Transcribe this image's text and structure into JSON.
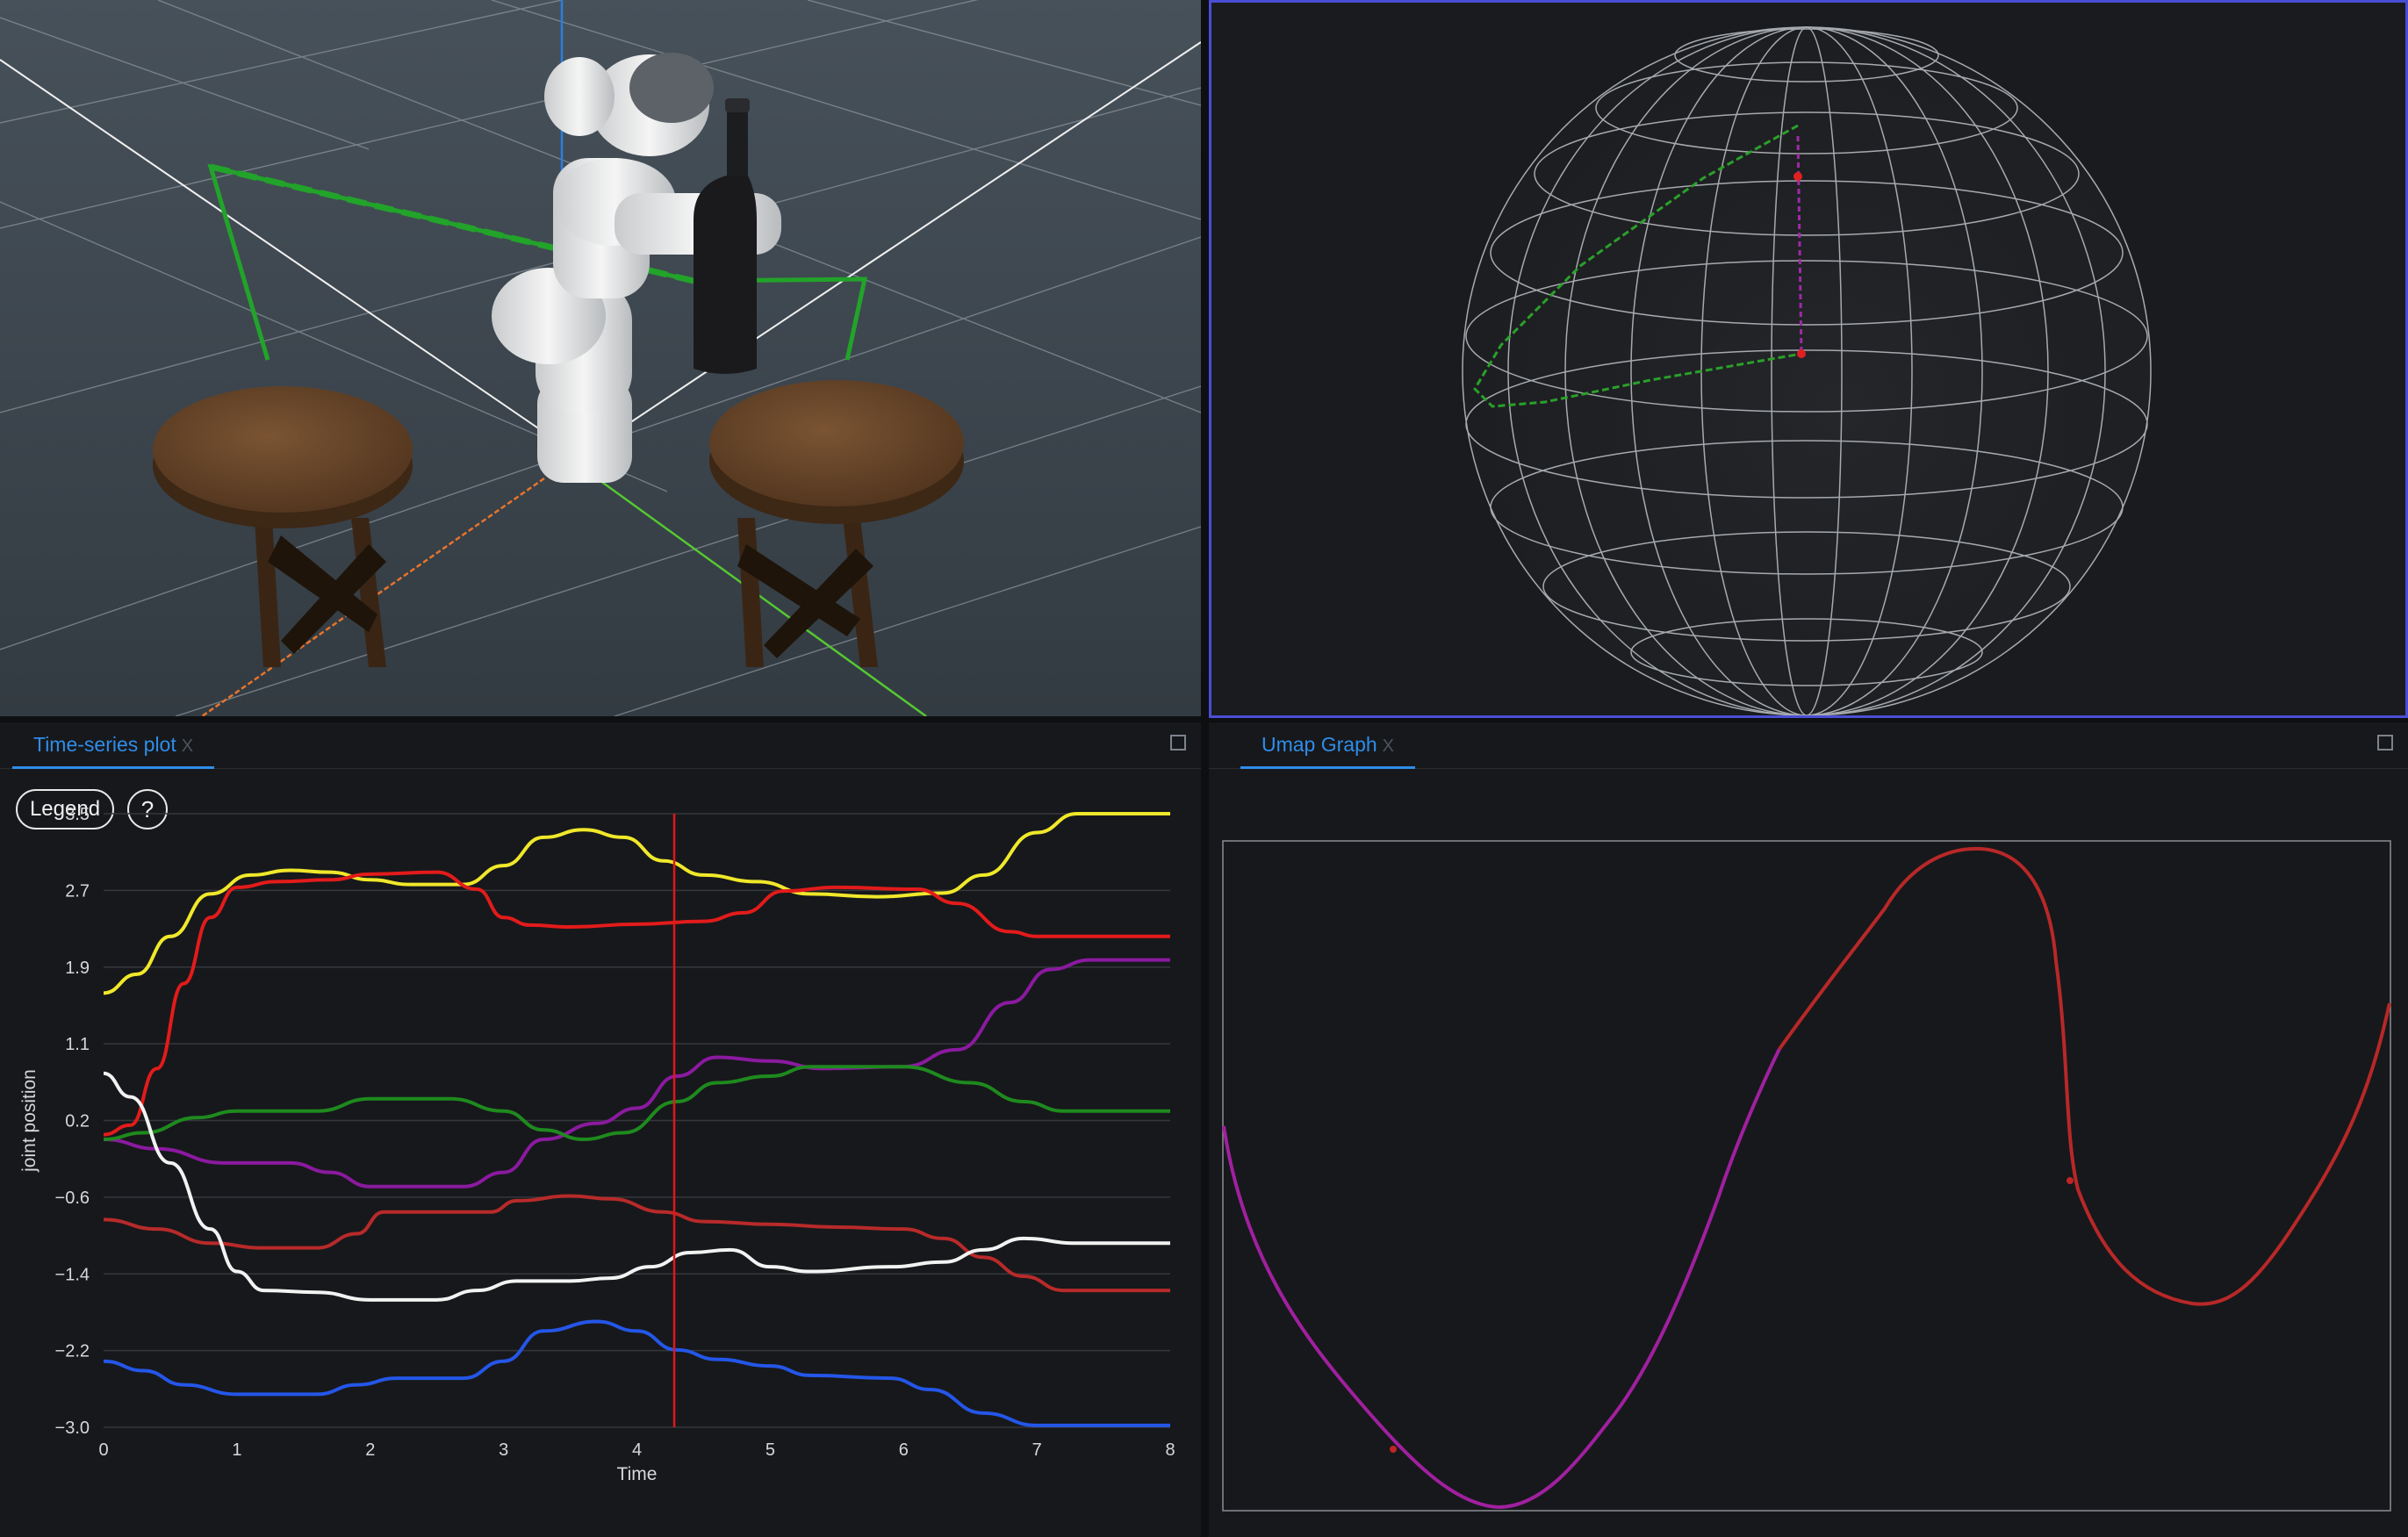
{
  "timeseries": {
    "tab_label": "Time-series plot",
    "tab_close": "X",
    "legend_button": "Legend",
    "help_button": "?"
  },
  "umap": {
    "tab_label": "Umap Graph",
    "tab_close": "X"
  },
  "colors": {
    "accent": "#2f8de8",
    "selection_border": "#4a4ed6",
    "panel_bg": "#17181b"
  },
  "chart_data": {
    "type": "line",
    "xlabel": "Time",
    "ylabel": "joint position",
    "xlim": [
      0,
      8
    ],
    "ylim": [
      -3.0,
      3.5
    ],
    "x_ticks": [
      "0",
      "1",
      "2",
      "3",
      "4",
      "5",
      "6",
      "7",
      "8"
    ],
    "y_ticks": [
      "3.5",
      "2.7",
      "1.9",
      "1.1",
      "0.2",
      "−0.6",
      "−1.4",
      "−2.2",
      "−3.0"
    ],
    "cursor_x": 4.28,
    "grid": "horizontal",
    "series": [
      {
        "color": "#f0e82a",
        "points": [
          [
            0,
            1.6
          ],
          [
            0.25,
            1.8
          ],
          [
            0.5,
            2.2
          ],
          [
            0.8,
            2.65
          ],
          [
            1.1,
            2.85
          ],
          [
            1.4,
            2.9
          ],
          [
            1.7,
            2.88
          ],
          [
            2.0,
            2.8
          ],
          [
            2.3,
            2.75
          ],
          [
            2.7,
            2.75
          ],
          [
            3.0,
            2.95
          ],
          [
            3.3,
            3.25
          ],
          [
            3.6,
            3.33
          ],
          [
            3.9,
            3.25
          ],
          [
            4.2,
            3.0
          ],
          [
            4.5,
            2.85
          ],
          [
            4.9,
            2.78
          ],
          [
            5.3,
            2.65
          ],
          [
            5.8,
            2.62
          ],
          [
            6.3,
            2.66
          ],
          [
            6.6,
            2.85
          ],
          [
            7.0,
            3.3
          ],
          [
            7.3,
            3.5
          ],
          [
            8,
            3.5
          ]
        ]
      },
      {
        "color": "#e31b1b",
        "points": [
          [
            0,
            0.1
          ],
          [
            0.2,
            0.2
          ],
          [
            0.4,
            0.8
          ],
          [
            0.6,
            1.7
          ],
          [
            0.8,
            2.4
          ],
          [
            1.0,
            2.72
          ],
          [
            1.3,
            2.78
          ],
          [
            1.7,
            2.8
          ],
          [
            2.0,
            2.86
          ],
          [
            2.5,
            2.88
          ],
          [
            2.8,
            2.7
          ],
          [
            3.0,
            2.4
          ],
          [
            3.2,
            2.32
          ],
          [
            3.5,
            2.3
          ],
          [
            4.0,
            2.33
          ],
          [
            4.5,
            2.36
          ],
          [
            4.8,
            2.45
          ],
          [
            5.1,
            2.68
          ],
          [
            5.5,
            2.72
          ],
          [
            6.1,
            2.7
          ],
          [
            6.4,
            2.55
          ],
          [
            6.8,
            2.25
          ],
          [
            7.0,
            2.2
          ],
          [
            8,
            2.2
          ]
        ]
      },
      {
        "color": "#8b1aa0",
        "points": [
          [
            0,
            0.05
          ],
          [
            0.4,
            -0.05
          ],
          [
            0.9,
            -0.2
          ],
          [
            1.4,
            -0.2
          ],
          [
            1.7,
            -0.3
          ],
          [
            2.0,
            -0.45
          ],
          [
            2.7,
            -0.45
          ],
          [
            3.0,
            -0.3
          ],
          [
            3.3,
            0.05
          ],
          [
            3.7,
            0.22
          ],
          [
            4.0,
            0.38
          ],
          [
            4.3,
            0.72
          ],
          [
            4.6,
            0.92
          ],
          [
            5.0,
            0.88
          ],
          [
            5.4,
            0.8
          ],
          [
            6.0,
            0.82
          ],
          [
            6.4,
            1.0
          ],
          [
            6.8,
            1.5
          ],
          [
            7.1,
            1.85
          ],
          [
            7.4,
            1.95
          ],
          [
            8,
            1.95
          ]
        ]
      },
      {
        "color": "#1e8a1e",
        "points": [
          [
            0,
            0.05
          ],
          [
            0.3,
            0.12
          ],
          [
            0.7,
            0.28
          ],
          [
            1.0,
            0.35
          ],
          [
            1.6,
            0.35
          ],
          [
            2.0,
            0.48
          ],
          [
            2.6,
            0.48
          ],
          [
            3.0,
            0.35
          ],
          [
            3.3,
            0.15
          ],
          [
            3.6,
            0.05
          ],
          [
            3.9,
            0.12
          ],
          [
            4.3,
            0.45
          ],
          [
            4.6,
            0.65
          ],
          [
            5.0,
            0.72
          ],
          [
            5.3,
            0.82
          ],
          [
            6.0,
            0.82
          ],
          [
            6.5,
            0.65
          ],
          [
            6.9,
            0.45
          ],
          [
            7.2,
            0.35
          ],
          [
            8,
            0.35
          ]
        ]
      },
      {
        "color": "#b82a2a",
        "points": [
          [
            0,
            -0.8
          ],
          [
            0.4,
            -0.9
          ],
          [
            0.8,
            -1.05
          ],
          [
            1.2,
            -1.1
          ],
          [
            1.6,
            -1.1
          ],
          [
            1.9,
            -0.95
          ],
          [
            2.1,
            -0.72
          ],
          [
            2.4,
            -0.72
          ],
          [
            2.9,
            -0.72
          ],
          [
            3.1,
            -0.6
          ],
          [
            3.5,
            -0.55
          ],
          [
            3.8,
            -0.58
          ],
          [
            4.2,
            -0.72
          ],
          [
            4.5,
            -0.82
          ],
          [
            5.0,
            -0.85
          ],
          [
            5.5,
            -0.88
          ],
          [
            6.0,
            -0.9
          ],
          [
            6.3,
            -1.0
          ],
          [
            6.6,
            -1.2
          ],
          [
            6.9,
            -1.4
          ],
          [
            7.2,
            -1.55
          ],
          [
            8,
            -1.55
          ]
        ]
      },
      {
        "color": "#f2f2f2",
        "points": [
          [
            0,
            0.75
          ],
          [
            0.2,
            0.5
          ],
          [
            0.5,
            -0.2
          ],
          [
            0.8,
            -0.9
          ],
          [
            1.0,
            -1.35
          ],
          [
            1.2,
            -1.55
          ],
          [
            1.6,
            -1.57
          ],
          [
            2.0,
            -1.65
          ],
          [
            2.5,
            -1.65
          ],
          [
            2.8,
            -1.55
          ],
          [
            3.1,
            -1.45
          ],
          [
            3.5,
            -1.45
          ],
          [
            3.8,
            -1.42
          ],
          [
            4.1,
            -1.3
          ],
          [
            4.4,
            -1.15
          ],
          [
            4.7,
            -1.12
          ],
          [
            5.0,
            -1.3
          ],
          [
            5.3,
            -1.35
          ],
          [
            5.9,
            -1.3
          ],
          [
            6.3,
            -1.25
          ],
          [
            6.6,
            -1.12
          ],
          [
            6.9,
            -1.0
          ],
          [
            7.3,
            -1.05
          ],
          [
            8,
            -1.05
          ]
        ]
      },
      {
        "color": "#2456e8",
        "points": [
          [
            0,
            -2.3
          ],
          [
            0.3,
            -2.4
          ],
          [
            0.6,
            -2.55
          ],
          [
            1.0,
            -2.65
          ],
          [
            1.6,
            -2.65
          ],
          [
            1.9,
            -2.55
          ],
          [
            2.2,
            -2.48
          ],
          [
            2.7,
            -2.48
          ],
          [
            3.0,
            -2.3
          ],
          [
            3.3,
            -1.98
          ],
          [
            3.7,
            -1.88
          ],
          [
            4.0,
            -1.98
          ],
          [
            4.3,
            -2.18
          ],
          [
            4.6,
            -2.28
          ],
          [
            5.0,
            -2.35
          ],
          [
            5.3,
            -2.45
          ],
          [
            5.9,
            -2.48
          ],
          [
            6.2,
            -2.6
          ],
          [
            6.6,
            -2.85
          ],
          [
            7.0,
            -2.98
          ],
          [
            8,
            -2.98
          ]
        ]
      }
    ]
  }
}
